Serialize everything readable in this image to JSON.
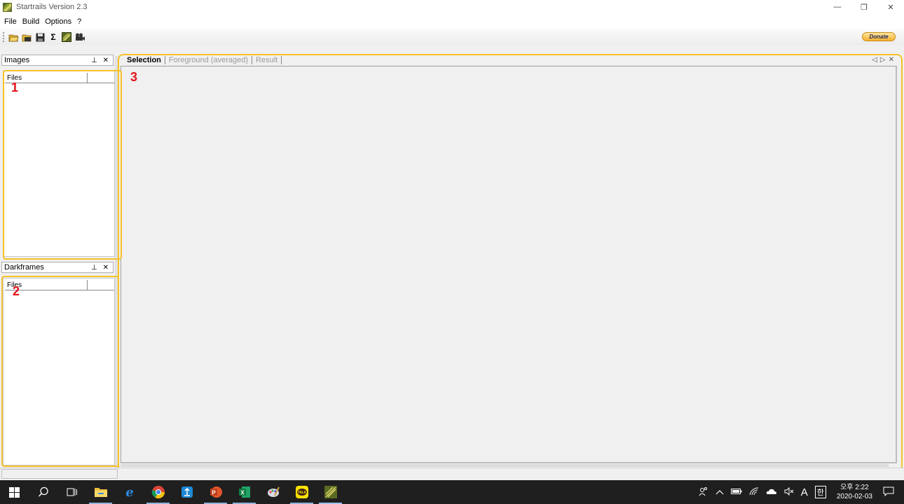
{
  "window": {
    "title": "Startrails Version 2.3",
    "controls": {
      "minimize": "—",
      "restore": "❐",
      "close": "✕"
    }
  },
  "menu": [
    "File",
    "Build",
    "Options",
    "?"
  ],
  "toolbar": {
    "icons": [
      "open-folder-icon",
      "open-darkframes-icon",
      "save-icon",
      "sum-icon",
      "startrails-icon",
      "video-icon"
    ],
    "sum_symbol": "Σ",
    "donate_label": "Donate"
  },
  "panels": {
    "images": {
      "title": "Images",
      "pin": "⊥",
      "close": "✕",
      "column": "Files"
    },
    "darkframes": {
      "title": "Darkframes",
      "pin": "⊥",
      "close": "✕",
      "column": "Files"
    }
  },
  "tabs": {
    "items": [
      {
        "label": "Selection",
        "active": true
      },
      {
        "label": "Foreground (averaged)",
        "active": false
      },
      {
        "label": "Result",
        "active": false
      }
    ],
    "nav": {
      "left": "◁",
      "right": "▷",
      "close": "✕"
    }
  },
  "annotations": {
    "a1": "1",
    "a2": "2",
    "a3": "3",
    "color": "#f7c228",
    "label_color": "#e4121b"
  },
  "taskbar": {
    "clock_time": "오후 2:22",
    "clock_date": "2020-02-03",
    "tray_ime": "A",
    "tray_ime2": "한"
  }
}
